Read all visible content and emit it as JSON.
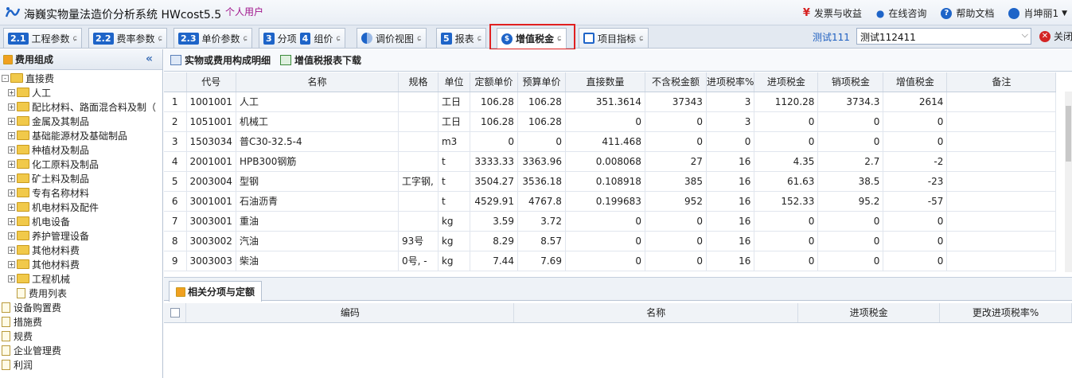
{
  "app": {
    "title": "海巍实物量法造价分析系统 HWcost5.5",
    "user_type": "个人用户",
    "right_items": [
      {
        "icon": "yen-icon",
        "label": "发票与收益"
      },
      {
        "icon": "support-icon",
        "label": "在线咨询"
      },
      {
        "icon": "help-icon",
        "label": "帮助文档"
      },
      {
        "icon": "user-icon",
        "label": "肖坤丽1"
      }
    ]
  },
  "tabs": [
    {
      "num": "2.1",
      "label": "工程参数"
    },
    {
      "num": "2.2",
      "label": "费率参数"
    },
    {
      "num": "2.3",
      "label": "单价参数"
    },
    {
      "num": "3",
      "label": "分项",
      "num2": "4",
      "label2": "组价"
    },
    {
      "label": "调价视图"
    },
    {
      "num": "5",
      "label": "报表"
    },
    {
      "label": "增值税金"
    },
    {
      "label": "项目指标"
    }
  ],
  "tab_close_glyph": "ɕ",
  "project": {
    "label": "测试111",
    "selected": "测试112411",
    "close_label": "关闭"
  },
  "left_panel": {
    "title": "费用组成",
    "collapse_glyph": "«",
    "tree": [
      {
        "level": 0,
        "type": "folder",
        "expander": "-",
        "label": "直接费"
      },
      {
        "level": 1,
        "type": "folder",
        "expander": "+",
        "label": "人工"
      },
      {
        "level": 1,
        "type": "folder",
        "expander": "+",
        "label": "配比材料、路面混合料及制（"
      },
      {
        "level": 1,
        "type": "folder",
        "expander": "+",
        "label": "金属及其制品"
      },
      {
        "level": 1,
        "type": "folder",
        "expander": "+",
        "label": "基础能源材及基础制品"
      },
      {
        "level": 1,
        "type": "folder",
        "expander": "+",
        "label": "种植材及制品"
      },
      {
        "level": 1,
        "type": "folder",
        "expander": "+",
        "label": "化工原料及制品"
      },
      {
        "level": 1,
        "type": "folder",
        "expander": "+",
        "label": "矿土料及制品"
      },
      {
        "level": 1,
        "type": "folder",
        "expander": "+",
        "label": "专有名称材料"
      },
      {
        "level": 1,
        "type": "folder",
        "expander": "+",
        "label": "机电材料及配件"
      },
      {
        "level": 1,
        "type": "folder",
        "expander": "+",
        "label": "机电设备"
      },
      {
        "level": 1,
        "type": "folder",
        "expander": "+",
        "label": "养护管理设备"
      },
      {
        "level": 1,
        "type": "folder",
        "expander": "+",
        "label": "其他材料费"
      },
      {
        "level": 1,
        "type": "folder",
        "expander": "+",
        "label": "其他材料费"
      },
      {
        "level": 1,
        "type": "folder",
        "expander": "+",
        "label": "工程机械"
      },
      {
        "level": 1,
        "type": "doc",
        "expander": "",
        "label": "费用列表"
      },
      {
        "level": 0,
        "type": "doc",
        "expander": "",
        "label": "设备购置费"
      },
      {
        "level": 0,
        "type": "doc",
        "expander": "",
        "label": "措施费"
      },
      {
        "level": 0,
        "type": "doc",
        "expander": "",
        "label": "规费"
      },
      {
        "level": 0,
        "type": "doc",
        "expander": "",
        "label": "企业管理费"
      },
      {
        "level": 0,
        "type": "doc",
        "expander": "",
        "label": "利润"
      }
    ]
  },
  "toolbar": {
    "detail_label": "实物或费用构成明细",
    "download_label": "增值税报表下载"
  },
  "grid": {
    "columns": [
      "",
      "代号",
      "名称",
      "规格",
      "单位",
      "定额单价",
      "预算单价",
      "直接数量",
      "不含税金额",
      "进项税率%",
      "进项税金",
      "销项税金",
      "增值税金",
      "备注"
    ],
    "rows": [
      [
        "1",
        "1001001",
        "人工",
        "",
        "工日",
        "106.28",
        "106.28",
        "351.3614",
        "37343",
        "3",
        "1120.28",
        "3734.3",
        "2614",
        ""
      ],
      [
        "2",
        "1051001",
        "机械工",
        "",
        "工日",
        "106.28",
        "106.28",
        "0",
        "0",
        "3",
        "0",
        "0",
        "0",
        ""
      ],
      [
        "3",
        "1503034",
        "普C30-32.5-4",
        "",
        "m3",
        "0",
        "0",
        "411.468",
        "0",
        "0",
        "0",
        "0",
        "0",
        ""
      ],
      [
        "4",
        "2001001",
        "HPB300钢筋",
        "",
        "t",
        "3333.33",
        "3363.96",
        "0.008068",
        "27",
        "16",
        "4.35",
        "2.7",
        "-2",
        ""
      ],
      [
        "5",
        "2003004",
        "型钢",
        "工字钢,",
        "t",
        "3504.27",
        "3536.18",
        "0.108918",
        "385",
        "16",
        "61.63",
        "38.5",
        "-23",
        ""
      ],
      [
        "6",
        "3001001",
        "石油沥青",
        "",
        "t",
        "4529.91",
        "4767.8",
        "0.199683",
        "952",
        "16",
        "152.33",
        "95.2",
        "-57",
        ""
      ],
      [
        "7",
        "3003001",
        "重油",
        "",
        "kg",
        "3.59",
        "3.72",
        "0",
        "0",
        "16",
        "0",
        "0",
        "0",
        ""
      ],
      [
        "8",
        "3003002",
        "汽油",
        "93号",
        "kg",
        "8.29",
        "8.57",
        "0",
        "0",
        "16",
        "0",
        "0",
        "0",
        ""
      ],
      [
        "9",
        "3003003",
        "柴油",
        "0号, -",
        "kg",
        "7.44",
        "7.69",
        "0",
        "0",
        "16",
        "0",
        "0",
        "0",
        ""
      ]
    ]
  },
  "bottom": {
    "tab_label": "相关分项与定额",
    "columns": [
      "",
      "编码",
      "名称",
      "进项税金",
      "更改进项税率%"
    ]
  },
  "colors": {
    "accent": "#1e64c8",
    "highlight": "#e02020",
    "brand": "#a0148c"
  }
}
